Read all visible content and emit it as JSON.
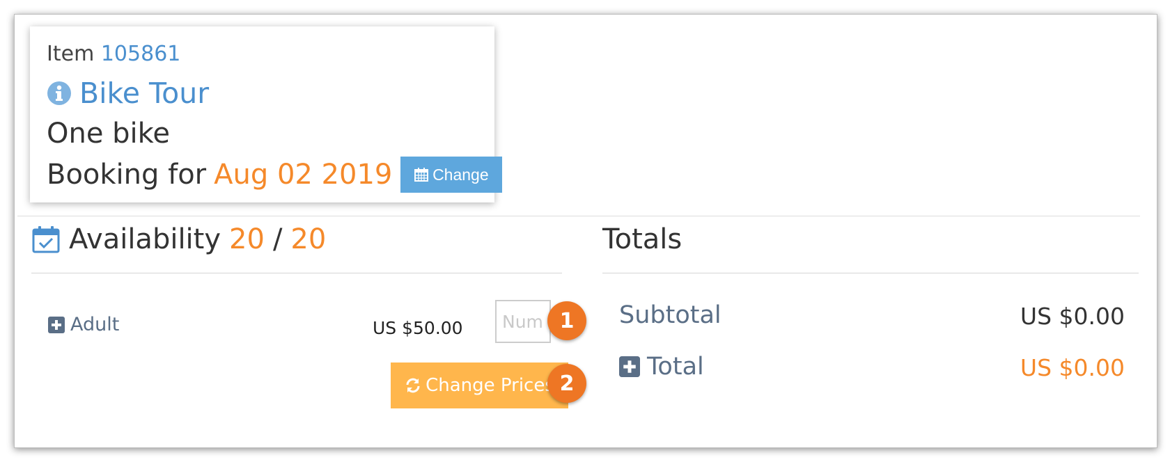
{
  "item_card": {
    "item_prefix": "Item",
    "item_number": "105861",
    "title": "Bike Tour",
    "description": "One bike",
    "booking_prefix": "Booking for",
    "booking_date": "Aug 02 2019",
    "change_label": "Change"
  },
  "availability": {
    "heading": "Availability",
    "available": "20",
    "separator": "/",
    "capacity": "20"
  },
  "pricing": {
    "adult_label": "Adult",
    "adult_price": "US $50.00",
    "quantity_placeholder": "Number",
    "quantity_value": "",
    "change_prices_label": "Change Prices"
  },
  "totals": {
    "heading": "Totals",
    "subtotal_label": "Subtotal",
    "subtotal_value": "US $0.00",
    "total_label": "Total",
    "total_value": "US $0.00"
  },
  "callouts": {
    "one": "1",
    "two": "2"
  },
  "colors": {
    "link_blue": "#4a8fce",
    "accent_orange": "#f5892a",
    "change_button": "#5ea7dd",
    "change_prices_button": "#ffb64c",
    "badge_orange": "#ee7624",
    "label_slate": "#5a6e86"
  },
  "icons": {
    "info": "info-circle-icon",
    "calendar": "calendar-icon",
    "calendar_check": "calendar-check-icon",
    "plus": "plus-square-icon",
    "refresh": "refresh-icon"
  }
}
